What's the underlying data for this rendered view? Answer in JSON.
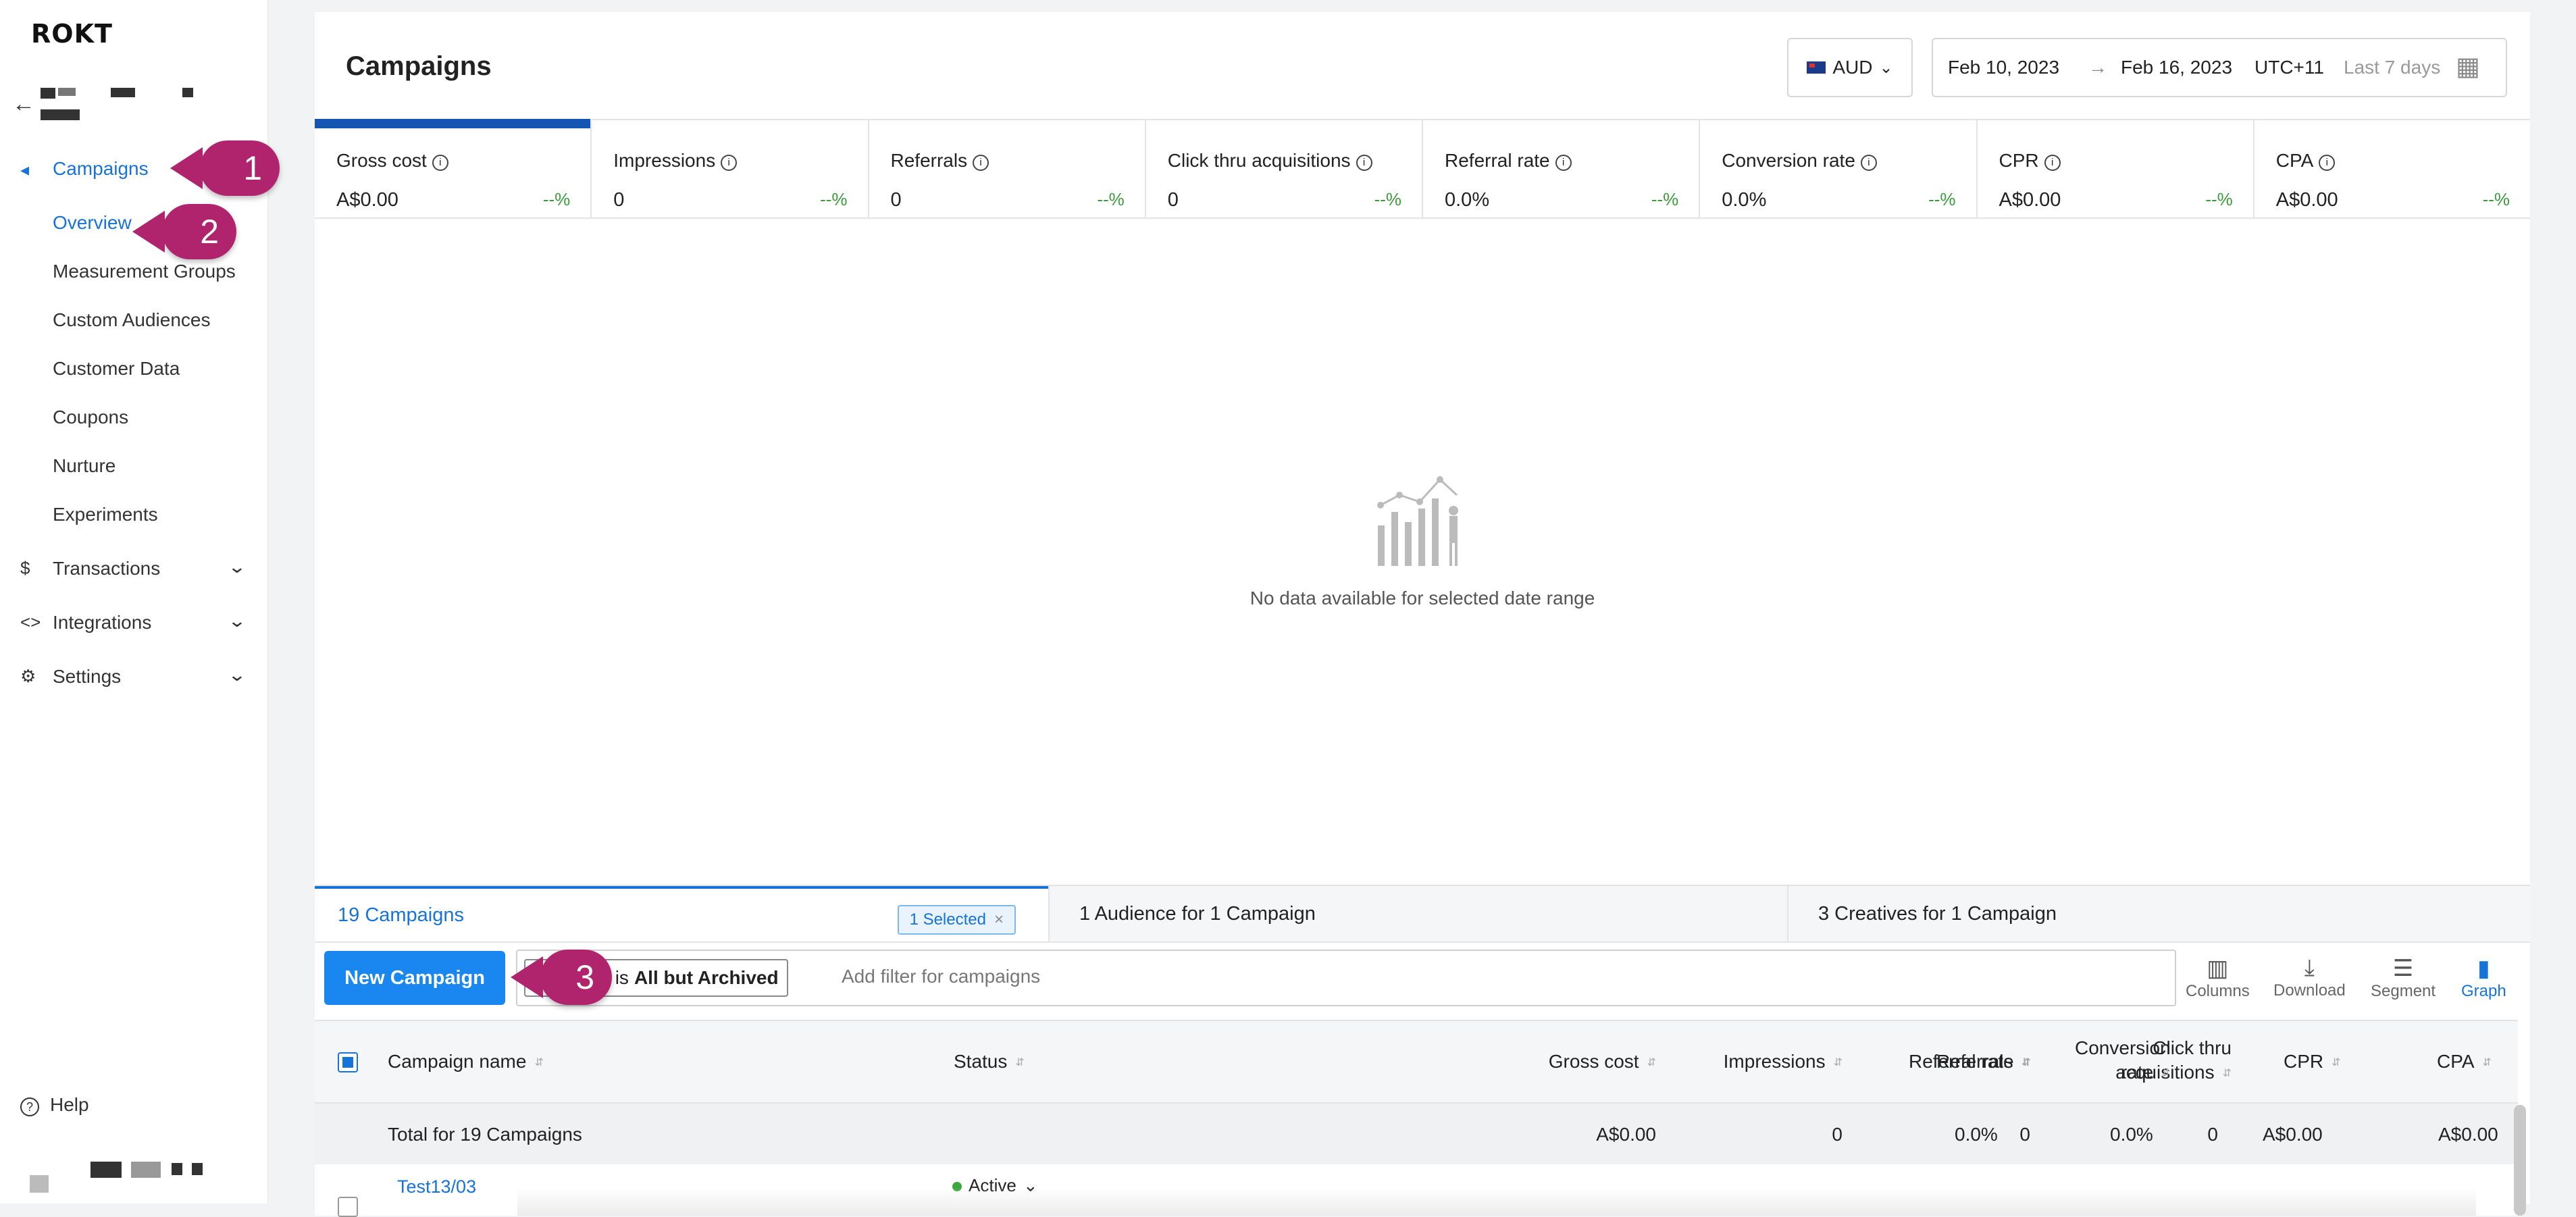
{
  "app": {
    "logo": "ROKT"
  },
  "sidebar": {
    "items": [
      {
        "label": "Campaigns",
        "active": true
      },
      {
        "label": "Overview",
        "active": true
      },
      {
        "label": "Measurement Groups"
      },
      {
        "label": "Custom Audiences"
      },
      {
        "label": "Customer Data"
      },
      {
        "label": "Coupons"
      },
      {
        "label": "Nurture"
      },
      {
        "label": "Experiments"
      },
      {
        "label": "Transactions"
      },
      {
        "label": "Integrations"
      },
      {
        "label": "Settings"
      }
    ],
    "help": "Help"
  },
  "callouts": [
    "1",
    "2",
    "3"
  ],
  "header": {
    "title": "Campaigns",
    "currency": "AUD",
    "date_from": "Feb 10, 2023",
    "date_arrow": "→",
    "date_to": "Feb 16, 2023",
    "timezone": "UTC+11",
    "range": "Last 7 days"
  },
  "metrics": [
    {
      "label": "Gross cost",
      "value": "A$0.00",
      "delta": "--%"
    },
    {
      "label": "Impressions",
      "value": "0",
      "delta": "--%"
    },
    {
      "label": "Referrals",
      "value": "0",
      "delta": "--%"
    },
    {
      "label": "Click thru acquisitions",
      "value": "0",
      "delta": "--%"
    },
    {
      "label": "Referral rate",
      "value": "0.0%",
      "delta": "--%"
    },
    {
      "label": "Conversion rate",
      "value": "0.0%",
      "delta": "--%"
    },
    {
      "label": "CPR",
      "value": "A$0.00",
      "delta": "--%"
    },
    {
      "label": "CPA",
      "value": "A$0.00",
      "delta": "--%"
    }
  ],
  "empty_state": "No data available for selected date range",
  "tabs": {
    "campaigns": "19 Campaigns",
    "selected": "1 Selected",
    "audiences": "1 Audience for 1 Campaign",
    "creatives": "3 Creatives for 1 Campaign"
  },
  "toolbar": {
    "new_campaign": "New Campaign",
    "filter_prefix": "atus is",
    "filter_value": "All but Archived",
    "filter_placeholder": "Add filter for campaigns",
    "columns": "Columns",
    "download": "Download",
    "segment": "Segment",
    "graph": "Graph"
  },
  "table": {
    "headers": {
      "name": "Campaign name",
      "status": "Status",
      "gross_cost": "Gross cost",
      "impressions": "Impressions",
      "referrals": "Referrals",
      "cta_1": "Click thru",
      "cta_2": "acquisitions",
      "referral_rate": "Referral rate",
      "conv_1": "Conversion",
      "conv_2": "rate",
      "cpr": "CPR",
      "cpa": "CPA"
    },
    "total": {
      "label": "Total for 19 Campaigns",
      "gross_cost": "A$0.00",
      "impressions": "0",
      "referrals": "0",
      "cta": "0",
      "referral_rate": "0.0%",
      "conversion_rate": "0.0%",
      "cpr": "A$0.00",
      "cpa": "A$0.00"
    },
    "rows": [
      {
        "name": "Test13/03",
        "status": "Active"
      }
    ]
  }
}
